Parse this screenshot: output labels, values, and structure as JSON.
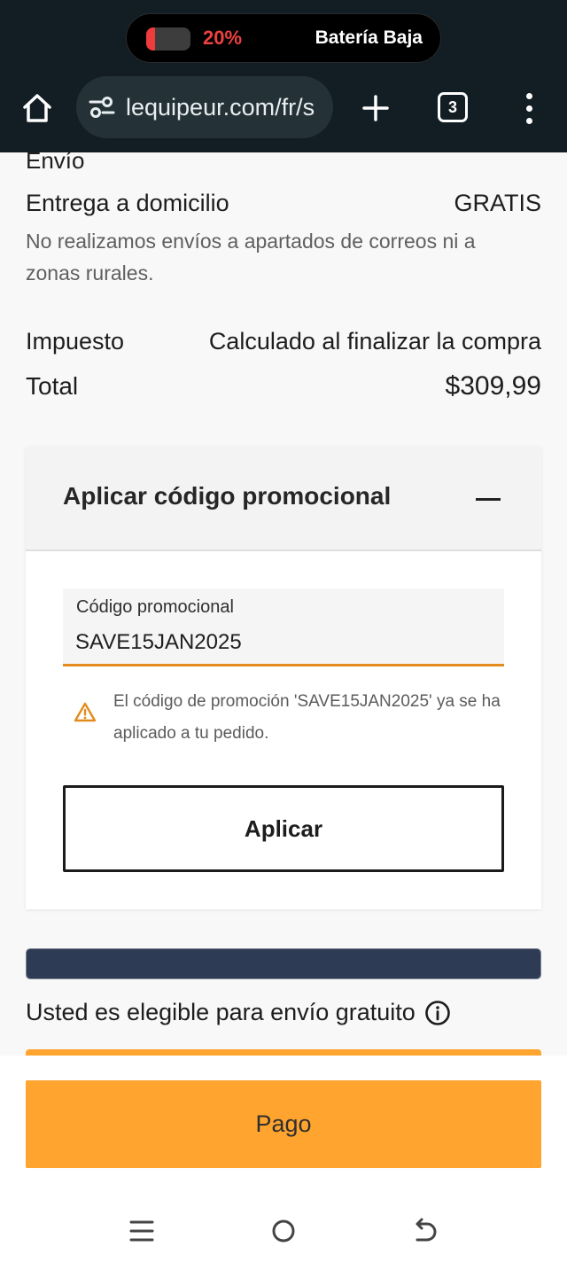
{
  "status": {
    "battery_percent": "20%",
    "battery_level": 0.2,
    "battery_label": "Batería Baja"
  },
  "browser": {
    "url": "lequipeur.com/fr/s",
    "tab_count": "3",
    "icons": [
      "home-icon",
      "site-settings-icon",
      "plus-icon",
      "tabs-icon",
      "more-vert-icon"
    ]
  },
  "summary": {
    "section_title": "Envío",
    "delivery_label": "Entrega a domicilio",
    "delivery_value": "GRATIS",
    "delivery_note": "No realizamos envíos a apartados de correos ni a zonas rurales.",
    "tax_label": "Impuesto",
    "tax_value": "Calculado al finalizar la compra",
    "total_label": "Total",
    "total_value": "$309,99"
  },
  "promo": {
    "title": "Aplicar código promocional",
    "field_label": "Código promocional",
    "field_value": "SAVE15JAN2025",
    "warning": "El código de promoción 'SAVE15JAN2025' ya se ha aplicado a tu pedido.",
    "apply_label": "Aplicar"
  },
  "shipping": {
    "progress": 1.0,
    "eligible_text": "Usted es elegible para envío gratuito"
  },
  "checkout": {
    "pay_label": "Pago"
  },
  "colors": {
    "accent": "#ffa42e",
    "progress": "#2e3b54",
    "field_underline": "#e38b1d",
    "battery_low": "#ee3b3b"
  }
}
